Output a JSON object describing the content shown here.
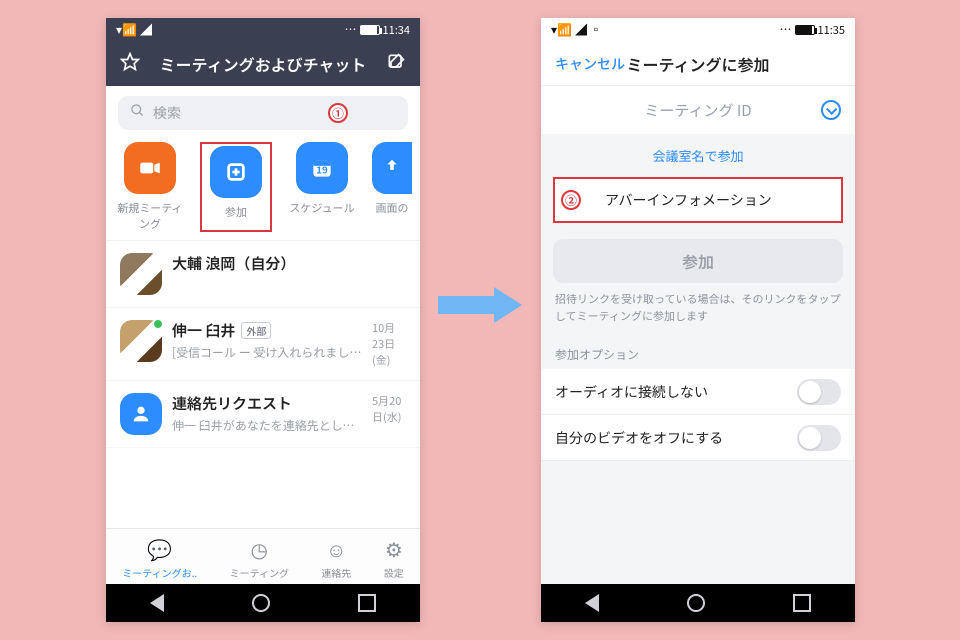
{
  "left": {
    "status": {
      "time": "11:34",
      "battery_pct": 90
    },
    "header_title": "ミーティングおよびチャット",
    "search_placeholder": "検索",
    "action_buttons": [
      {
        "label": "新規ミーティング",
        "icon": "video-icon",
        "color": "orange"
      },
      {
        "label": "参加",
        "icon": "plus-icon",
        "color": "blue"
      },
      {
        "label": "スケジュール",
        "icon": "calendar-icon",
        "color": "blue",
        "badge": "19"
      },
      {
        "label": "画面の",
        "icon": "share-icon",
        "color": "blue"
      }
    ],
    "chats": [
      {
        "title": "大輔 浪岡（自分）",
        "subtitle": "",
        "date": "",
        "avatar": "cat"
      },
      {
        "title": "伸一 臼井",
        "ext": "外部",
        "subtitle": "[受信コール ー 受け入れられました]",
        "date": "10月23日(金)",
        "avatar": "dog",
        "presence": true
      },
      {
        "title": "連絡先リクエスト",
        "subtitle": "伸一 臼井があなたを連絡先として追加し...",
        "date": "5月20日(水)",
        "avatar": "blue"
      }
    ],
    "tabs": [
      {
        "label": "ミーティングお..",
        "active": true
      },
      {
        "label": "ミーティング",
        "active": false
      },
      {
        "label": "連絡先",
        "active": false
      },
      {
        "label": "設定",
        "active": false
      }
    ],
    "callout_number": "①"
  },
  "right": {
    "status": {
      "time": "11:35",
      "battery_pct": 90
    },
    "cancel": "キャンセル",
    "header_title": "ミーティングに参加",
    "meeting_id_label": "ミーティング ID",
    "room_name_link": "会議室名で参加",
    "name_value": "アバーインフォメーション",
    "join_label": "参加",
    "hint": "招待リンクを受け取っている場合は、そのリンクをタップしてミーティングに参加します",
    "options_label": "参加オプション",
    "toggles": [
      {
        "label": "オーディオに接続しない",
        "on": false
      },
      {
        "label": "自分のビデオをオフにする",
        "on": false
      }
    ],
    "callout_number": "②"
  }
}
